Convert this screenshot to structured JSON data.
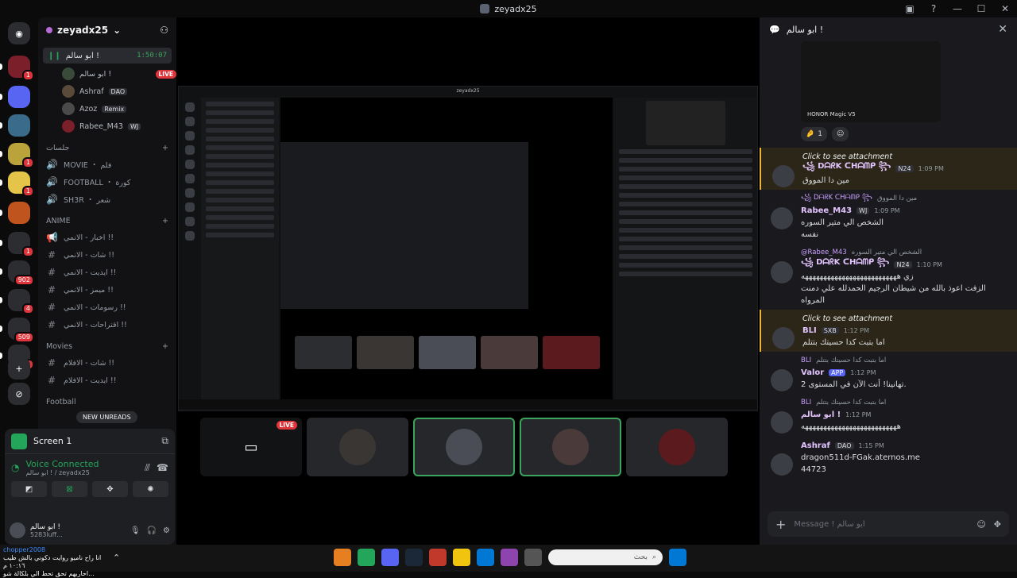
{
  "window": {
    "title": "zeyadx25"
  },
  "rail": {
    "servers": [
      {
        "name": "server-1",
        "badge": "1",
        "color": "#7b1f2a"
      },
      {
        "name": "server-2",
        "badge": "",
        "color": "#5865f2"
      },
      {
        "name": "server-3",
        "badge": "",
        "color": "#3a6b8a"
      },
      {
        "name": "server-4",
        "badge": "1",
        "color": "#b9a33a"
      },
      {
        "name": "server-5",
        "badge": "1",
        "color": "#e4c54a"
      },
      {
        "name": "server-6",
        "badge": "",
        "color": "#c0541e"
      },
      {
        "name": "server-7",
        "badge": "1",
        "color": "#2b2d31"
      },
      {
        "name": "server-8",
        "badge": "902",
        "color": "#2b2d31"
      },
      {
        "name": "server-9",
        "badge": "4",
        "color": "#2b2d31"
      },
      {
        "name": "server-10",
        "badge": "509",
        "color": "#2b2d31"
      },
      {
        "name": "server-11",
        "badge": "85",
        "color": "#2b2d31"
      }
    ],
    "add_label": "+",
    "discover_label": "⊘"
  },
  "sidebar": {
    "guild_name": "zeyadx25",
    "voice_channel": {
      "name": "ابو سالم !",
      "time": "1:50:07"
    },
    "voice_users": [
      {
        "name": "ابو سالم !",
        "live": "LIVE",
        "tag": ""
      },
      {
        "name": "Ashraf",
        "live": "",
        "tag": "DAO"
      },
      {
        "name": "Azoz",
        "live": "",
        "tag": "Remix"
      },
      {
        "name": "Rabee_M43",
        "live": "",
        "tag": "WJ"
      }
    ],
    "category1": "جلسات",
    "channels1": [
      {
        "icon": "🔊",
        "name": "MOVIE ・ فلم"
      },
      {
        "icon": "🔊",
        "name": "FOOTBALL ・ كورة"
      },
      {
        "icon": "🔊",
        "name": "SH3R ・ شعر"
      }
    ],
    "category2": "ANIME",
    "channels2": [
      {
        "icon": "📢",
        "name": "اخبار - الانمي !!"
      },
      {
        "icon": "#",
        "name": "شات - الانمي !!"
      },
      {
        "icon": "#",
        "name": "ايديت - الانمي !!"
      },
      {
        "icon": "#",
        "name": "ميمز - الانمي !!"
      },
      {
        "icon": "#",
        "name": "رسومات - الانمي !!"
      },
      {
        "icon": "#",
        "name": "اقتراحات - الانمي !!"
      }
    ],
    "category3": "Movies",
    "channels3": [
      {
        "icon": "#",
        "name": "شات - الافلام !!"
      },
      {
        "icon": "#",
        "name": "ايديت - الافلام !!"
      }
    ],
    "category4": "Football",
    "new_unreads": "NEW UNREADS"
  },
  "panel": {
    "title": "Screen 1",
    "voice_connected": "Voice Connected",
    "voice_sub": "ابو سالم ! / zeyadx25",
    "user_name": "ابو سالم !",
    "user_status": "5283luff..."
  },
  "stream": {
    "nested_title": "zeyadx25",
    "tiles": [
      {
        "name": "screen-share",
        "live": "LIVE",
        "color": "#121315"
      },
      {
        "name": "hollow-knight",
        "live": "",
        "color": "#3a3633"
      },
      {
        "name": "armored-figure",
        "live": "",
        "color": "#4a4d55"
      },
      {
        "name": "smiling-girl",
        "live": "",
        "color": "#4a3a3a"
      },
      {
        "name": "red-character",
        "live": "",
        "color": "#5a1a1e"
      }
    ]
  },
  "chat": {
    "header": "ابو سالم !",
    "image_caption": "HONOR Magic V5",
    "reaction_count": "1",
    "messages": [
      {
        "reply_name": "",
        "reply_text": "Click to see attachment",
        "name": "꧁ DᗩᖇK ᑕHᗩᗰᑭ ꧂",
        "tag": "N24",
        "time": "1:09 PM",
        "text": "مين دا المووق",
        "hl": true
      },
      {
        "reply_name": "꧁ DᗩᖇK ᑕHᗩᗰᑭ ꧂",
        "reply_text": "مين دا المووق",
        "name": "Rabee_M43",
        "tag": "WJ",
        "time": "1:09 PM",
        "text": "الشخص الي متير السوره",
        "text2": "نفسه",
        "hl": false
      },
      {
        "reply_name": "@Rabee_M43",
        "reply_text": "الشخص الي متير السوره",
        "name": "꧁ DᗩᖇK ᑕHᗩᗰᑭ ꧂",
        "tag": "N24",
        "time": "1:10 PM",
        "text": "زي ههههههههههههههههههههههههههه",
        "text2": "الزفت اعوذ بالله من شيطان الرجيم الحمدلله علي دمنت المرواه",
        "hl": false
      },
      {
        "reply_name": "",
        "reply_text": "Click to see attachment",
        "name": "BLI",
        "tag": "SXB",
        "time": "1:12 PM",
        "text": "اما بتبت كدا حسيتك بتتلم",
        "hl": true
      },
      {
        "reply_name": "BLI",
        "reply_text": "اما بتبت كدا حسيتك بتتلم",
        "name": "Valor",
        "tag": "APP",
        "time": "1:12 PM",
        "text": "تهانينا! أنت الآن في المستوى 2.",
        "hl": false
      },
      {
        "reply_name": "BLI",
        "reply_text": "اما بتبت كدا حسيتك بتتلم",
        "name": "ابو سالم !",
        "tag": "",
        "time": "1:12 PM",
        "text": "ههههههههههههههههههههههههههه",
        "hl": false
      },
      {
        "reply_name": "",
        "reply_text": "",
        "name": "Ashraf",
        "tag": "DAO",
        "time": "1:15 PM",
        "text": "dragon511d-FGak.aternos.me",
        "text2": "44723",
        "hl": false
      }
    ],
    "placeholder": "Message ! ابو سالم"
  },
  "taskbar": {
    "left_line1": "chopper2008",
    "left_line2": "انا راح ناميو روايت دكوني بالش طيب",
    "left_line3": "١٠:١٦ م",
    "left_line4": "احاربهم تحق تحط الي بلكالة شو...",
    "search_placeholder": "بحث"
  }
}
